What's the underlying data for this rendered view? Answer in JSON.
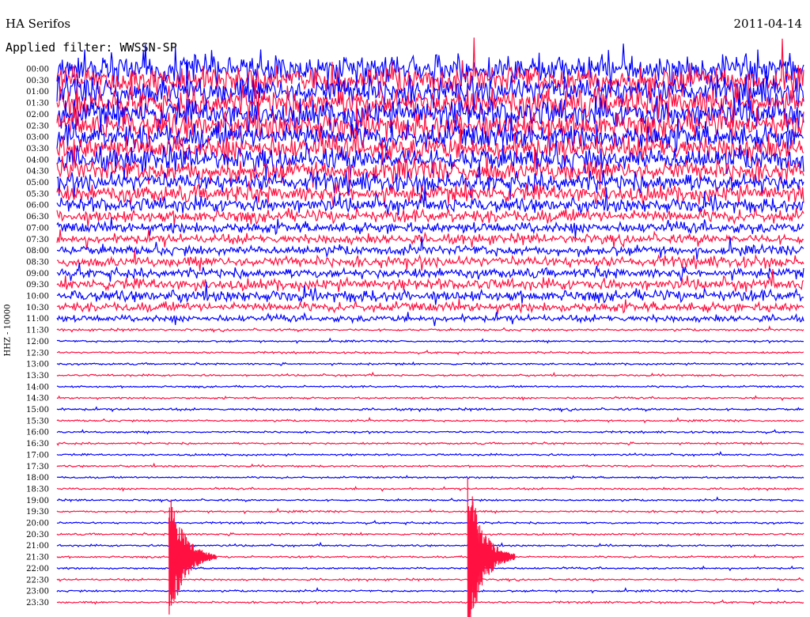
{
  "header": {
    "station": "HA Serifos",
    "date": "2011-04-14",
    "filter_label": "Applied filter: WWSSN-SP",
    "channel_label": "HHZ - 10000"
  },
  "chart_data": {
    "type": "line",
    "title": "HA Serifos",
    "date": "2011-04-14",
    "ylabel": "HHZ - 10000",
    "grid": false,
    "colors": {
      "odd_rows": "#0000ff",
      "even_rows": "#ff1040"
    },
    "row_times": [
      "00:00",
      "00:30",
      "01:00",
      "01:30",
      "02:00",
      "02:30",
      "03:00",
      "03:30",
      "04:00",
      "04:30",
      "05:00",
      "05:30",
      "06:00",
      "06:30",
      "07:00",
      "07:30",
      "08:00",
      "08:30",
      "09:00",
      "09:30",
      "10:00",
      "10:30",
      "11:00",
      "11:30",
      "12:00",
      "12:30",
      "13:00",
      "13:30",
      "14:00",
      "14:30",
      "15:00",
      "15:30",
      "16:00",
      "16:30",
      "17:00",
      "17:30",
      "18:00",
      "18:30",
      "19:00",
      "19:30",
      "20:00",
      "20:30",
      "21:00",
      "21:30",
      "22:00",
      "22:30",
      "23:00",
      "23:30"
    ],
    "noise_amplitude": [
      4.0,
      4.0,
      4.0,
      4.0,
      3.8,
      3.8,
      3.6,
      3.4,
      3.2,
      3.0,
      2.6,
      2.3,
      2.0,
      1.8,
      1.5,
      1.3,
      1.3,
      1.5,
      1.3,
      1.5,
      1.6,
      1.3,
      0.9,
      0.3,
      0.25,
      0.25,
      0.25,
      0.25,
      0.25,
      0.25,
      0.3,
      0.25,
      0.25,
      0.25,
      0.25,
      0.25,
      0.25,
      0.25,
      0.25,
      0.25,
      0.25,
      0.25,
      0.25,
      0.25,
      0.25,
      0.25,
      0.25,
      0.25
    ],
    "events": [
      {
        "row": "21:30",
        "minute": 4.5,
        "peak_amplitude": 10
      },
      {
        "row": "21:30",
        "minute": 16.5,
        "peak_amplitude": 12
      }
    ]
  }
}
